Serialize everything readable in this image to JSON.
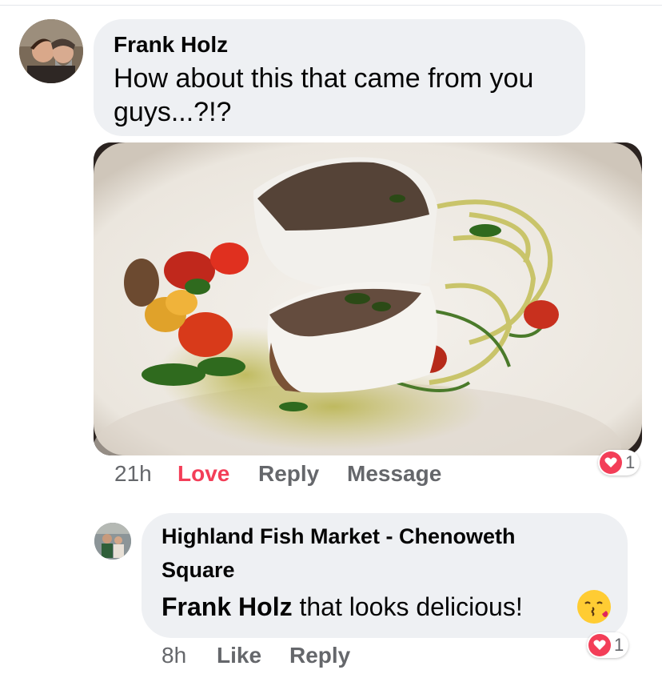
{
  "comment1": {
    "author": "Frank Holz",
    "text_line1": "How about this that came from you",
    "text_line2": "guys...?!?",
    "actions": {
      "time": "21h",
      "love": "Love",
      "reply": "Reply",
      "message": "Message"
    },
    "reaction": {
      "icon": "heart-icon",
      "count": "1"
    }
  },
  "reply1": {
    "author_line1": "Highland Fish Market - Chenoweth",
    "author_line2": "Square",
    "mention": "Frank Holz",
    "text": " that looks delicious!",
    "emoji": "kissing-face-emoji",
    "actions": {
      "time": "8h",
      "like": "Like",
      "reply": "Reply"
    },
    "reaction": {
      "icon": "heart-icon",
      "count": "1"
    }
  },
  "colors": {
    "love": "#f33e58",
    "bubble": "#eef0f3",
    "muted": "#65676b",
    "text": "#050505"
  }
}
